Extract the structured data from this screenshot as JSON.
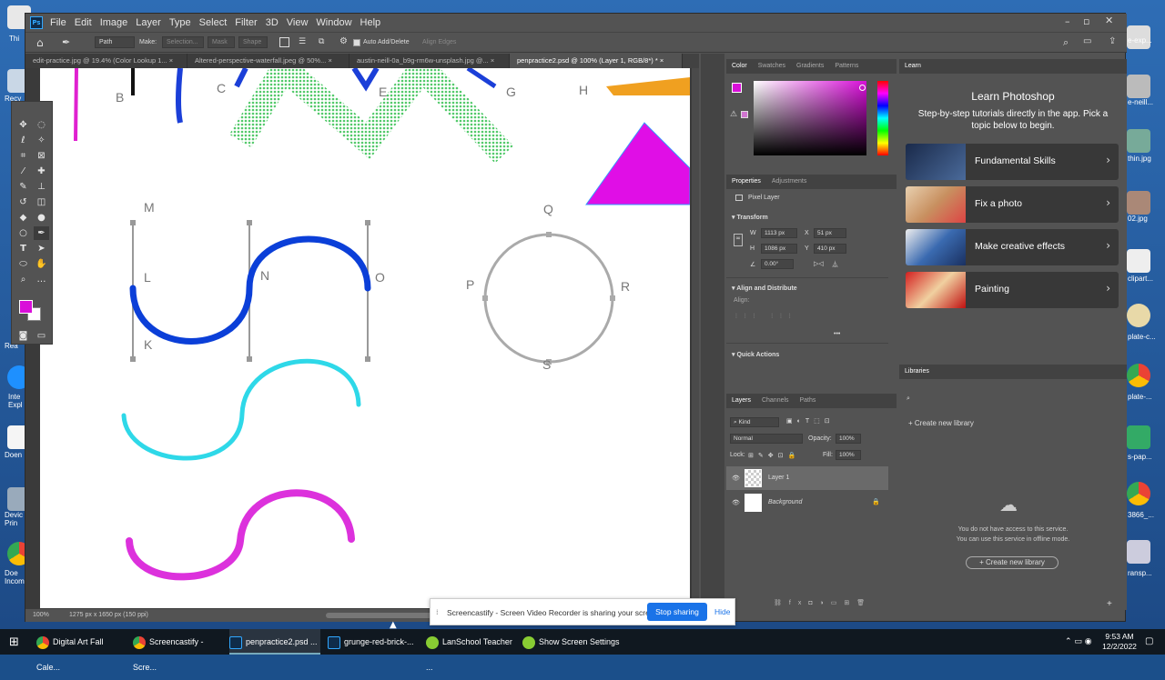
{
  "app": {
    "logo": "Ps",
    "menu": [
      "File",
      "Edit",
      "Image",
      "Layer",
      "Type",
      "Select",
      "Filter",
      "3D",
      "View",
      "Window",
      "Help"
    ]
  },
  "options_bar": {
    "tool_mode": "Path",
    "make_label": "Make:",
    "selection_btn": "Selection...",
    "mask_btn": "Mask",
    "shape_btn": "Shape",
    "auto_add_delete": "Auto Add/Delete",
    "align_edges": "Align Edges"
  },
  "doc_tabs": [
    {
      "label": "edit-practice.jpg @ 19.4% (Color Lookup 1...",
      "close": "×"
    },
    {
      "label": "Altered-perspective-waterfall.jpeg @ 50%...",
      "close": "×"
    },
    {
      "label": "austin-neill-0a_b9g-rm6w-unsplash.jpg @...",
      "close": "×"
    },
    {
      "label": "penpractice2.psd @ 100% (Layer 1, RGB/8*) *",
      "close": "×"
    }
  ],
  "canvas_labels": {
    "B": "B",
    "C": "C",
    "E": "E",
    "G": "G",
    "H": "H",
    "M": "M",
    "L": "L",
    "N": "N",
    "O": "O",
    "K": "K",
    "Q": "Q",
    "P": "P",
    "R": "R",
    "S": "S"
  },
  "status": {
    "zoom": "100%",
    "doc_size": "1275 px x 1650 px (150 ppi)"
  },
  "color_panel": {
    "tabs": [
      "Color",
      "Swatches",
      "Gradients",
      "Patterns"
    ],
    "foreground": "#d90fd9",
    "background": "#ffffff"
  },
  "properties_panel": {
    "tabs": [
      "Properties",
      "Adjustments"
    ],
    "kind": "Pixel Layer",
    "transform_title": "Transform",
    "w": "1113 px",
    "h": "1086 px",
    "x": "51 px",
    "y": "410 px",
    "w_label": "W",
    "h_label": "H",
    "x_label": "X",
    "y_label": "Y",
    "angle": "0.00°",
    "align_title": "Align and Distribute",
    "align_label": "Align:",
    "quick_actions": "Quick Actions"
  },
  "layers_panel": {
    "tabs": [
      "Layers",
      "Channels",
      "Paths"
    ],
    "filter": "Kind",
    "blend": "Normal",
    "opacity_label": "Opacity:",
    "opacity": "100%",
    "lock_label": "Lock:",
    "fill_label": "Fill:",
    "fill": "100%",
    "layers": [
      {
        "name": "Layer 1",
        "selected": true
      },
      {
        "name": "Background",
        "selected": false
      }
    ]
  },
  "learn_panel": {
    "tab": "Learn",
    "title": "Learn Photoshop",
    "desc": "Step-by-step tutorials directly in the app. Pick a topic below to begin.",
    "cards": [
      {
        "label": "Fundamental Skills"
      },
      {
        "label": "Fix a photo"
      },
      {
        "label": "Make creative effects"
      },
      {
        "label": "Painting"
      }
    ]
  },
  "libraries_panel": {
    "tab": "Libraries",
    "create": "Create new library",
    "msg1": "You do not have access to this service.",
    "msg2": "You can use this service in offline mode.",
    "create_btn": "+ Create new library"
  },
  "share_bar": {
    "text": "Screencastify - Screen Video Recorder is sharing your screen.",
    "stop": "Stop sharing",
    "hide": "Hide"
  },
  "desktop_icons_left": [
    "Thi",
    "Recy",
    "Rea",
    "Inte Expl",
    "Doen",
    "Devic Prin",
    "Doe Incom"
  ],
  "desktop_icons_right": [
    "e-exp...",
    "e-neill...",
    "thin.jpg",
    "02.jpg",
    "clipart...",
    "plate-c...",
    "plate-...",
    "s-pap...",
    "3866_...",
    "ransp..."
  ],
  "taskbar": {
    "items": [
      "Digital Art Fall Cale...",
      "Screencastify - Scre...",
      "penpractice2.psd ...",
      "grunge-red-brick-...",
      "LanSchool Teacher ...",
      "Show Screen Settings"
    ],
    "time": "9:53 AM",
    "date": "12/2/2022"
  }
}
